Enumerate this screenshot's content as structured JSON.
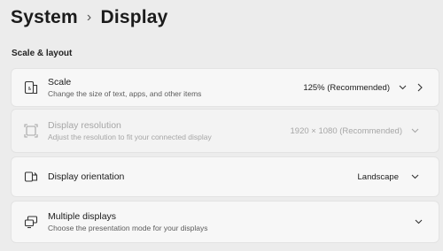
{
  "breadcrumb": {
    "parent": "System",
    "separator": "›",
    "current": "Display"
  },
  "section": {
    "title": "Scale & layout"
  },
  "scale": {
    "title": "Scale",
    "subtitle": "Change the size of text, apps, and other items",
    "value": "125% (Recommended)"
  },
  "resolution": {
    "title": "Display resolution",
    "subtitle": "Adjust the resolution to fit your connected display",
    "value": "1920 × 1080 (Recommended)"
  },
  "orientation": {
    "title": "Display orientation",
    "value": "Landscape"
  },
  "multiple_displays": {
    "title": "Multiple displays",
    "subtitle": "Choose the presentation mode for your displays"
  }
}
